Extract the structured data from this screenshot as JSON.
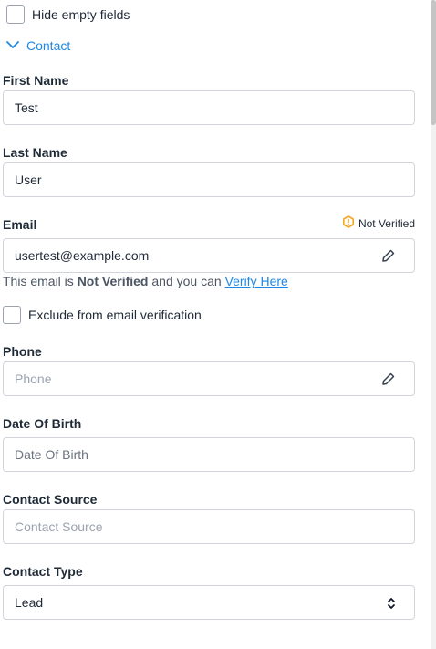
{
  "hide_empty": {
    "label": "Hide empty fields"
  },
  "section": {
    "label": "Contact"
  },
  "fields": {
    "first_name": {
      "label": "First Name",
      "value": "Test"
    },
    "last_name": {
      "label": "Last Name",
      "value": "User"
    },
    "email": {
      "label": "Email",
      "value": "usertest@example.com",
      "status": "Not Verified",
      "help_prefix": "This email is",
      "help_status": "Not Verified",
      "help_middle": "and you can",
      "help_link": "Verify Here"
    },
    "exclude_verification": {
      "label": "Exclude from email verification"
    },
    "phone": {
      "label": "Phone",
      "placeholder": "Phone"
    },
    "dob": {
      "label": "Date Of Birth",
      "placeholder": "Date Of Birth"
    },
    "contact_source": {
      "label": "Contact Source",
      "placeholder": "Contact Source"
    },
    "contact_type": {
      "label": "Contact Type",
      "value": "Lead"
    }
  },
  "colors": {
    "accent": "#1e88e5",
    "warning": "#f5a623"
  }
}
